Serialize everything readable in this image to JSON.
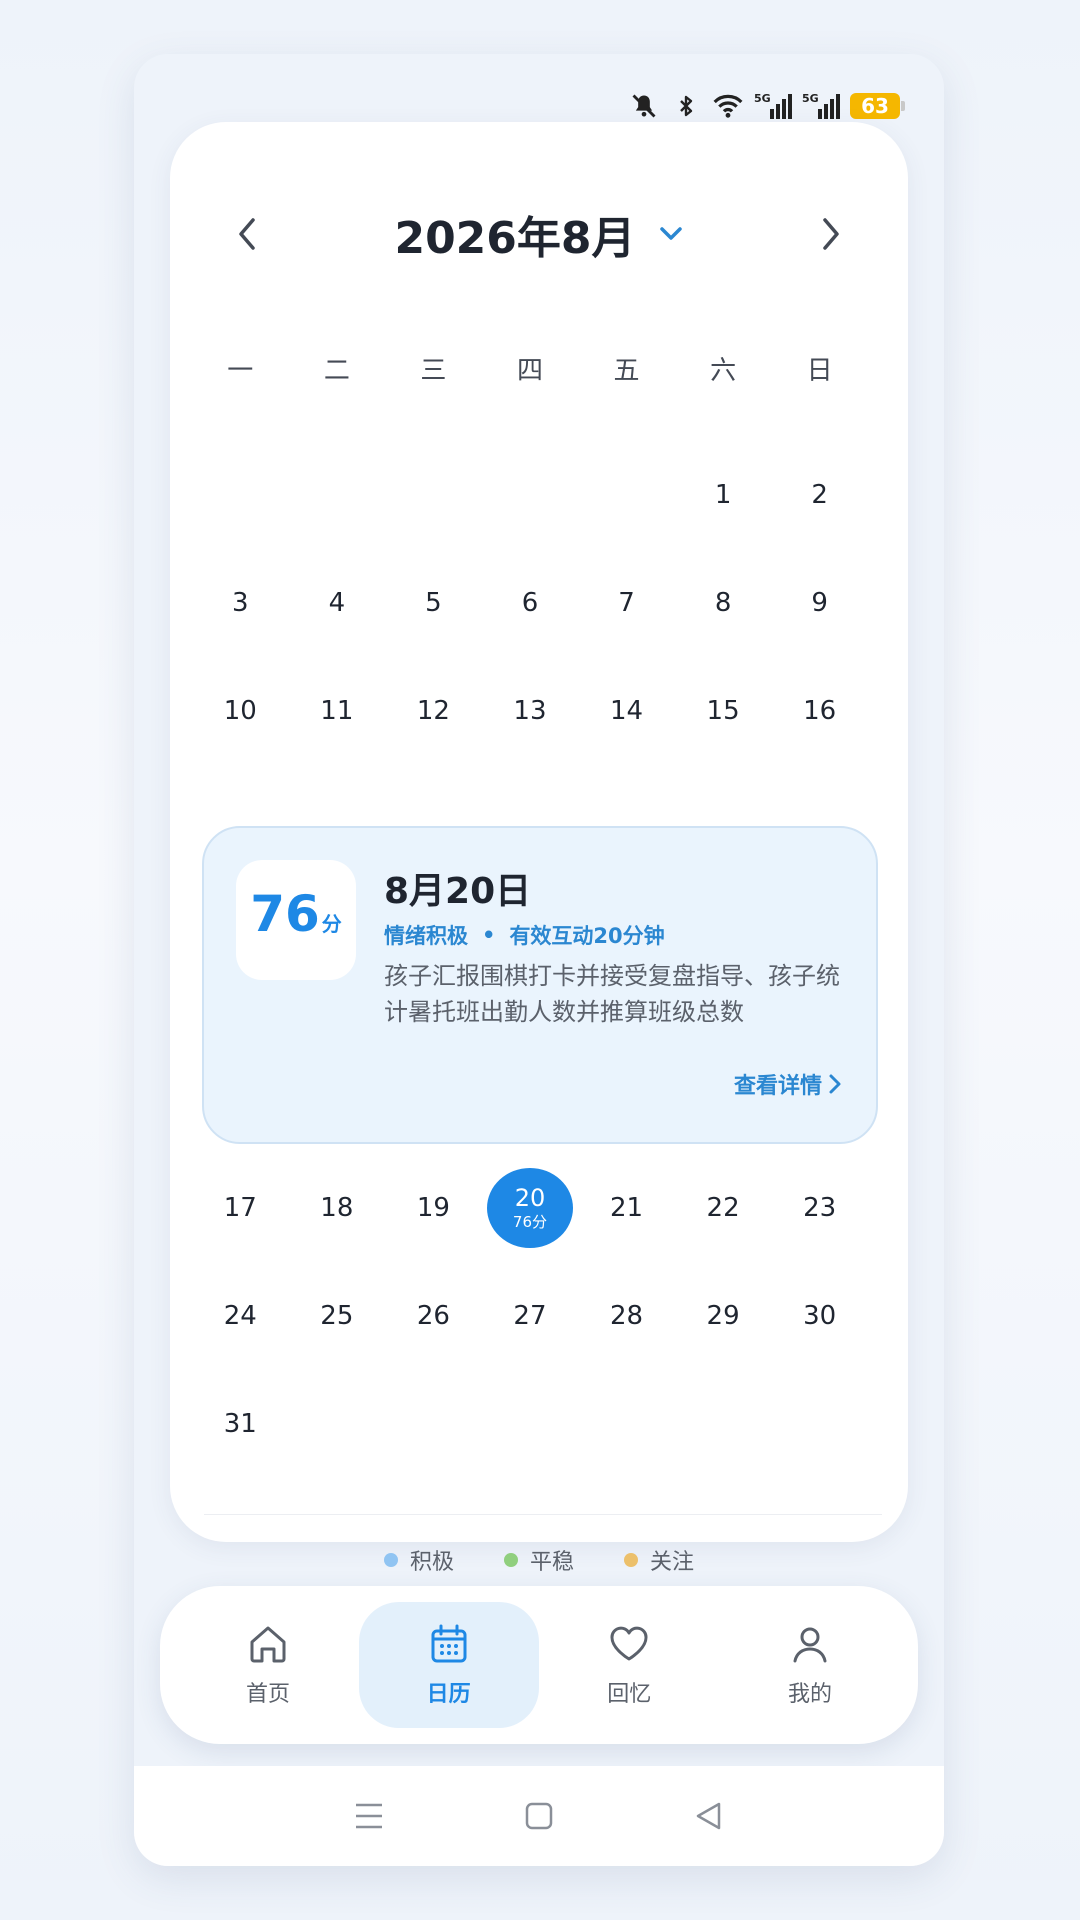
{
  "status_bar": {
    "battery": "63",
    "icons": [
      "mute-bell-icon",
      "bluetooth-icon",
      "wifi-icon",
      "5g-signal-icon",
      "5g-signal-icon"
    ],
    "signal_label": "5G"
  },
  "calendar": {
    "title": "2026年8月",
    "weekdays": [
      "一",
      "二",
      "三",
      "四",
      "五",
      "六",
      "日"
    ],
    "weeks": [
      [
        "",
        "",
        "",
        "",
        "",
        "1",
        "2"
      ],
      [
        "3",
        "4",
        "5",
        "6",
        "7",
        "8",
        "9"
      ],
      [
        "10",
        "11",
        "12",
        "13",
        "14",
        "15",
        "16"
      ],
      [
        "17",
        "18",
        "19",
        "20",
        "21",
        "22",
        "23"
      ],
      [
        "24",
        "25",
        "26",
        "27",
        "28",
        "29",
        "30"
      ],
      [
        "31",
        "",
        "",
        "",
        "",
        "",
        ""
      ]
    ],
    "selected": {
      "day": "20",
      "score": "76分"
    }
  },
  "detail": {
    "score": "76",
    "score_unit": "分",
    "date": "8月20日",
    "mood": "情绪积极",
    "separator": "•",
    "interaction": "有效互动20分钟",
    "summary": "孩子汇报围棋打卡并接受复盘指导、孩子统计暑托班出勤人数并推算班级总数",
    "link": "查看详情"
  },
  "legend": [
    {
      "label": "积极",
      "color": "#90c4f2"
    },
    {
      "label": "平稳",
      "color": "#90cf7e"
    },
    {
      "label": "关注",
      "color": "#ecc06b"
    }
  ],
  "nav": [
    {
      "label": "首页",
      "icon": "home-icon"
    },
    {
      "label": "日历",
      "icon": "calendar-icon",
      "active": true
    },
    {
      "label": "回忆",
      "icon": "heart-icon"
    },
    {
      "label": "我的",
      "icon": "user-icon"
    }
  ],
  "colors": {
    "accent": "#1e88e5",
    "detail_bg": "#eaf4fd"
  }
}
